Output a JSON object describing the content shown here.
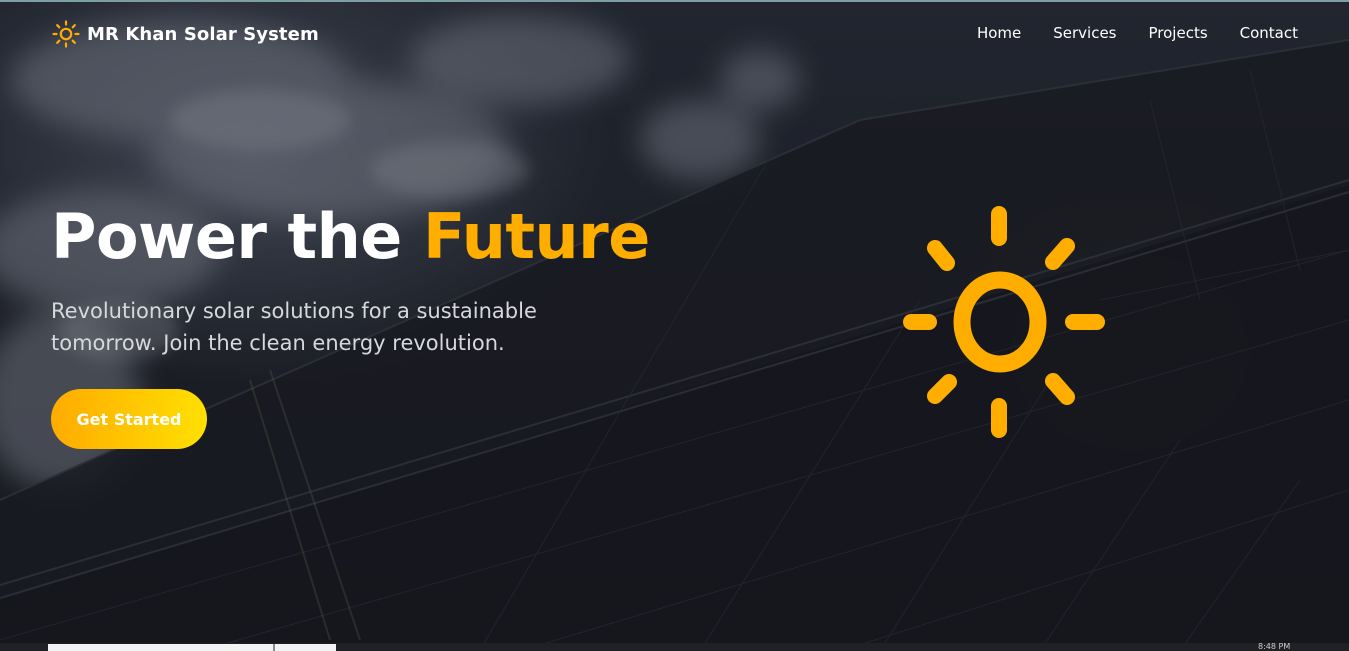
{
  "brand": {
    "name": "MR Khan Solar System",
    "icon": "sun-icon",
    "color": "#ffae00"
  },
  "nav": {
    "links": [
      "Home",
      "Services",
      "Projects",
      "Contact"
    ]
  },
  "hero": {
    "title_main": "Power the",
    "title_accent": "Future",
    "subtitle": "Revolutionary solar solutions for a sustainable tomorrow. Join the clean energy revolution.",
    "cta_label": "Get Started",
    "accent_color": "#ffae00",
    "illustration": "sun-icon"
  },
  "taskbar": {
    "clock": "8:48 PM"
  }
}
